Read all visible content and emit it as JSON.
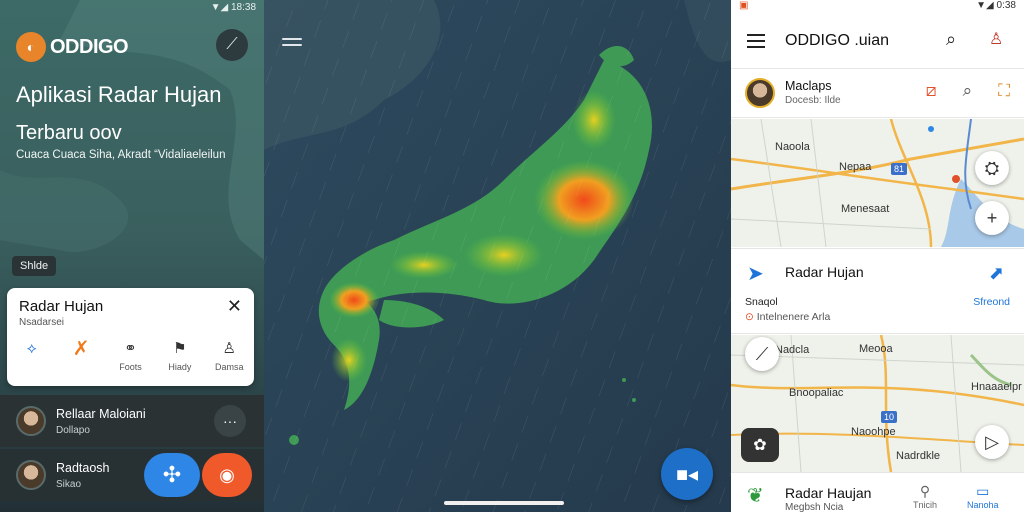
{
  "left": {
    "status": "▼◢ 18:38",
    "logo": "ODDIGO",
    "header_icon": "pin-icon",
    "hero_title": "Aplikasi Radar Hujan",
    "hero_subtitle": "Terbaru oov",
    "hero_desc": "Cuaca Cuaca Siha, Akradt “Vidaliaeleilun",
    "tag": "Shlde",
    "card": {
      "title": "Radar Hujan",
      "subtitle": "Nsadarsei",
      "actions": [
        {
          "label": "",
          "icon": "navigate-icon"
        },
        {
          "label": "",
          "icon": "tools-icon"
        },
        {
          "label": "Foots",
          "icon": "people-icon"
        },
        {
          "label": "Hiady",
          "icon": "flag-icon"
        },
        {
          "label": "Damsa",
          "icon": "person-icon"
        }
      ]
    },
    "rows": [
      {
        "name": "Rellaar Maloiani",
        "sub": "Dollapo"
      },
      {
        "name": "Radtaosh",
        "sub": "Sikao"
      }
    ]
  },
  "center": {
    "map_type": "radar-precipitation-japan"
  },
  "right": {
    "status_left": "▣",
    "status_right": "▼◢ 0:38",
    "title": "ODDIGO .uian",
    "profile": {
      "name": "Maclaps",
      "sub": "Docesb: Ilde"
    },
    "map1_labels": [
      "Naoola",
      "Nepaa",
      "Menesaat"
    ],
    "map1_road": "81",
    "info": {
      "title": "Radar Hujan",
      "label": "Snaqol",
      "action": "Sfreond",
      "location": "Intelnenere Arla"
    },
    "map2_labels": [
      "Nadcla",
      "Meooa",
      "Bnoopaliac",
      "Hnaaaelpr",
      "Naoohpe",
      "Nadrdkle"
    ],
    "map2_road": "10",
    "bottom": {
      "title": "Radar Haujan",
      "sub": "Megbsh Ncia",
      "nav": [
        {
          "label": "Tnicih",
          "icon": "pin-icon"
        },
        {
          "label": "Nanoha",
          "icon": "chat-icon"
        }
      ]
    }
  }
}
